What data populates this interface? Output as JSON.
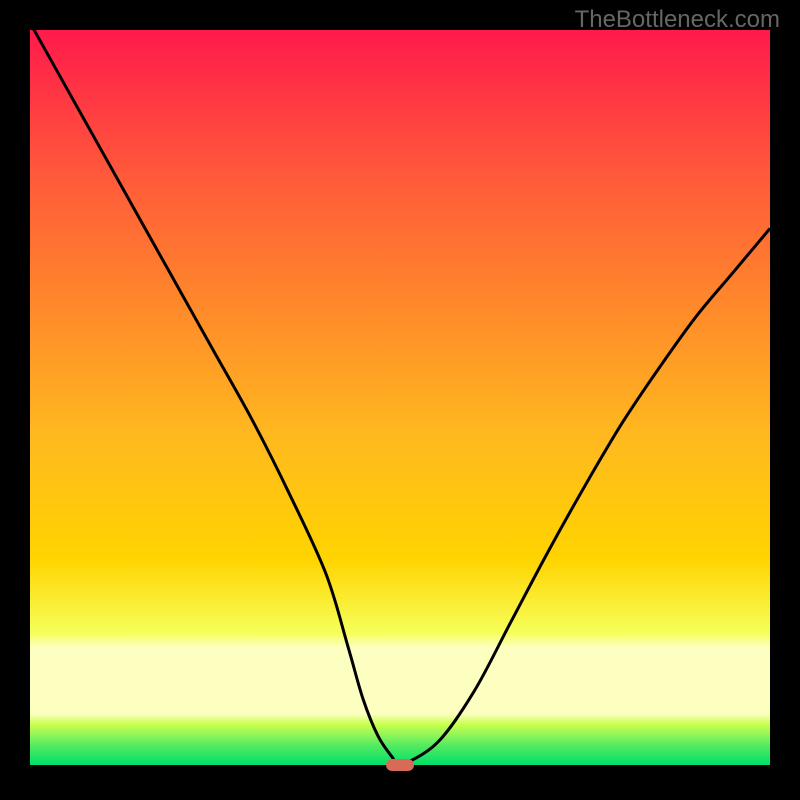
{
  "watermark": "TheBottleneck.com",
  "colors": {
    "top": "#ff1a4b",
    "mid": "#ffd400",
    "green_top": "#c8ff4b",
    "green_bottom": "#00e06a",
    "curve": "#000000",
    "marker": "#d86b57",
    "page_bg": "#000000",
    "panel_bg": "#ffffff"
  },
  "chart_data": {
    "type": "line",
    "title": "",
    "xlabel": "",
    "ylabel": "",
    "xlim": [
      0,
      100
    ],
    "ylim": [
      0,
      100
    ],
    "series": [
      {
        "name": "bottleneck-curve",
        "x": [
          0,
          5,
          10,
          15,
          20,
          25,
          30,
          35,
          40,
          43,
          45,
          47,
          49,
          50,
          55,
          60,
          65,
          70,
          75,
          80,
          85,
          90,
          95,
          100
        ],
        "y": [
          101,
          92,
          83,
          74,
          65,
          56,
          47,
          37,
          26,
          16,
          9,
          4,
          1,
          0,
          3,
          10,
          19.5,
          29,
          38,
          46.5,
          54,
          61,
          67,
          73
        ]
      }
    ],
    "annotations": [
      {
        "name": "curve-minimum-marker",
        "x": 50,
        "y": 0
      }
    ],
    "grid": false,
    "legend": false
  }
}
